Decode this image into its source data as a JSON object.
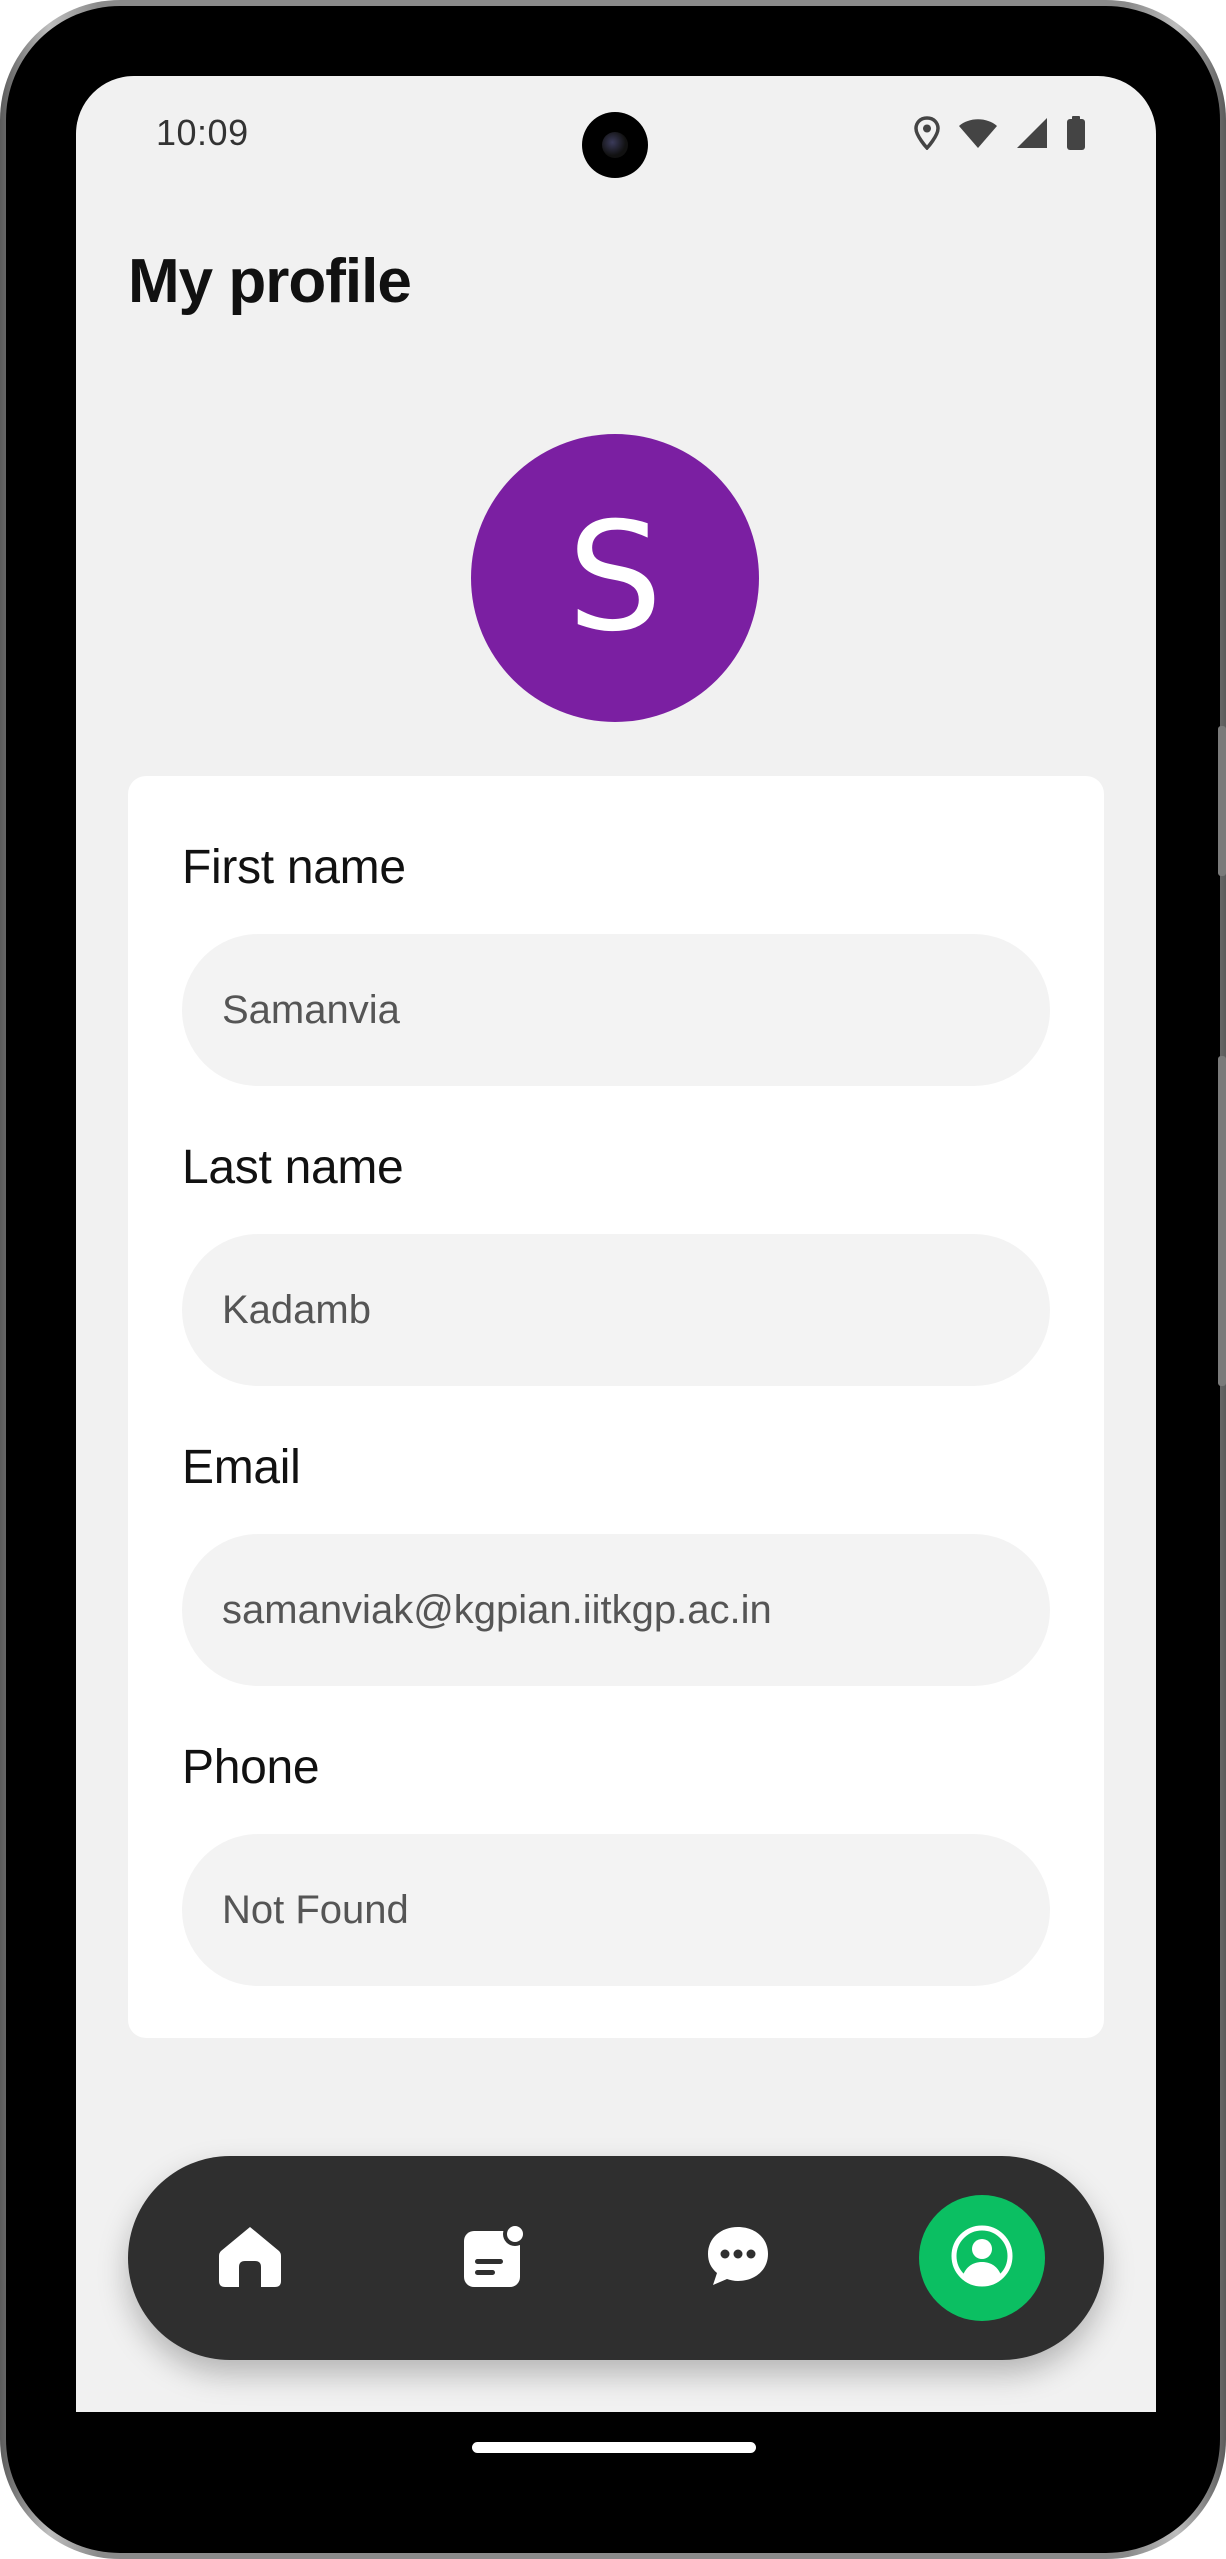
{
  "status_bar": {
    "time": "10:09",
    "icons": [
      "location-icon",
      "wifi-icon",
      "cellular-signal-icon",
      "battery-icon"
    ]
  },
  "header": {
    "title": "My profile"
  },
  "avatar": {
    "initial": "S",
    "color": "#7b1fa2"
  },
  "profile_form": {
    "first_name": {
      "label": "First name",
      "value": "Samanvia"
    },
    "last_name": {
      "label": "Last name",
      "value": "Kadamb"
    },
    "email": {
      "label": "Email",
      "value": "samanviak@kgpian.iitkgp.ac.in"
    },
    "phone": {
      "label": "Phone",
      "value": "Not Found"
    }
  },
  "bottom_nav": {
    "items": [
      {
        "id": "home",
        "icon": "home-icon",
        "active": false
      },
      {
        "id": "notes",
        "icon": "notes-notification-icon",
        "active": false
      },
      {
        "id": "chat",
        "icon": "chat-icon",
        "active": false
      },
      {
        "id": "profile",
        "icon": "profile-icon",
        "active": true
      }
    ],
    "active_color": "#0bbf62",
    "background_color": "#2f2f2f"
  }
}
